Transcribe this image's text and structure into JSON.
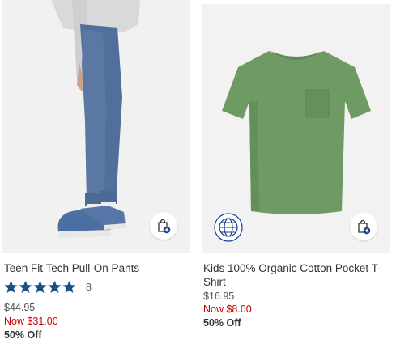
{
  "products": [
    {
      "name": "Teen Fit Tech Pull-On Pants",
      "rating_stars": 5,
      "review_count": "8",
      "original_price": "$44.95",
      "sale_price": "Now $31.00",
      "discount": "50% Off",
      "image_icon": "pants-photo",
      "bag_icon": "add-to-bag-icon"
    },
    {
      "name": "Kids 100% Organic Cotton Pocket T-Shirt",
      "original_price": "$16.95",
      "sale_price": "Now $8.00",
      "discount": "50% Off",
      "image_icon": "tshirt-photo",
      "badge_icon": "globe-icon",
      "bag_icon": "add-to-bag-icon"
    }
  ],
  "colors": {
    "star": "#1a4e8c",
    "sale": "#d00000",
    "bag_accent": "#1a3d8c",
    "shirt": "#6f9a63",
    "pants": "#4f6f9c"
  }
}
